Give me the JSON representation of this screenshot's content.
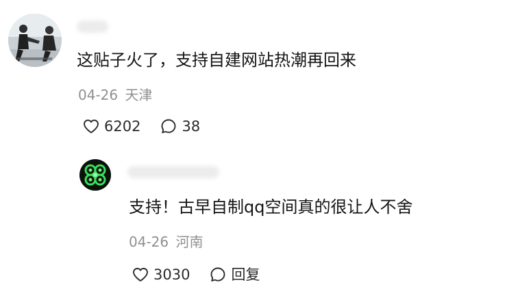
{
  "comments": [
    {
      "text": "这贴子火了，支持自建网站热潮再回来",
      "date": "04-26",
      "location": "天津",
      "likes": "6202",
      "replies": "38",
      "avatar_icon": "photo-avatar"
    },
    {
      "text": "支持！古早自制qq空间真的很让人不舍",
      "date": "04-26",
      "location": "河南",
      "likes": "3030",
      "reply_label": "回复",
      "avatar_icon": "clover-avatar"
    }
  ]
}
